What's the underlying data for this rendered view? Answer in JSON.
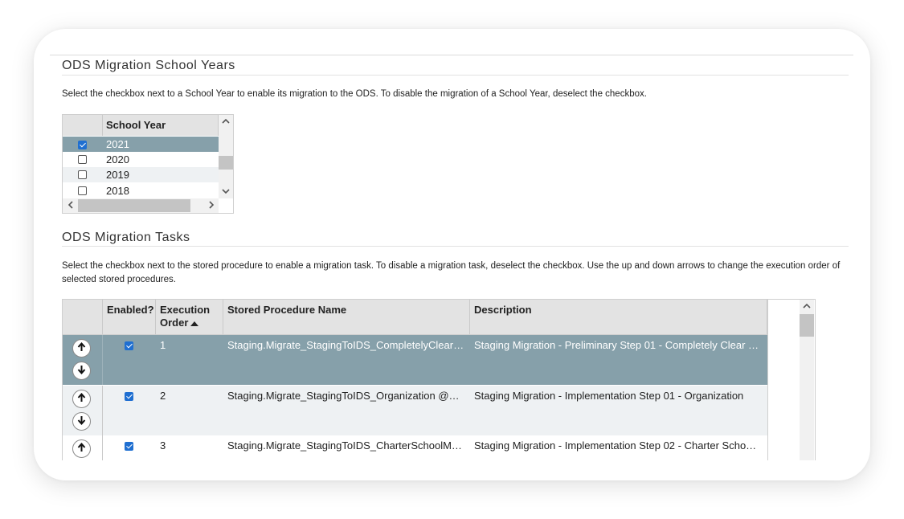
{
  "section_years": {
    "title": "ODS Migration School Years",
    "description": "Select the checkbox next to a School Year to enable its migration to the ODS. To disable the migration of a School Year, deselect the checkbox.",
    "grid": {
      "column_header": "School Year",
      "rows": [
        {
          "year": "2021",
          "checked": true,
          "selected": true
        },
        {
          "year": "2020",
          "checked": false,
          "selected": false
        },
        {
          "year": "2019",
          "checked": false,
          "selected": false
        },
        {
          "year": "2018",
          "checked": false,
          "selected": false
        }
      ]
    }
  },
  "section_tasks": {
    "title": "ODS Migration Tasks",
    "description": "Select the checkbox next to the stored procedure to enable a migration task. To disable a migration task, deselect the checkbox. Use the up and down arrows to change the execution order of selected stored procedures.",
    "grid": {
      "headers": {
        "enabled": "Enabled?",
        "order_line1": "Execution",
        "order_line2": "Order",
        "procedure": "Stored Procedure Name",
        "description": "Description"
      },
      "rows": [
        {
          "enabled": true,
          "order": "1",
          "procedure": "Staging.Migrate_StagingToIDS_CompletelyClear…",
          "description": "Staging Migration - Preliminary Step 01 - Completely Clear …"
        },
        {
          "enabled": true,
          "order": "2",
          "procedure": "Staging.Migrate_StagingToIDS_Organization @…",
          "description": "Staging Migration - Implementation Step 01 - Organization"
        },
        {
          "enabled": true,
          "order": "3",
          "procedure": "Staging.Migrate_StagingToIDS_CharterSchoolM…",
          "description": "Staging Migration - Implementation Step 02 - Charter Scho…"
        }
      ]
    }
  },
  "icons": {
    "move_up": "arrow-up-icon",
    "move_down": "arrow-down-icon",
    "scroll_up": "chevron-up-icon",
    "scroll_down": "chevron-down-icon",
    "scroll_left": "chevron-left-icon",
    "scroll_right": "chevron-right-icon",
    "sort": "sort-ascending-icon"
  },
  "colors": {
    "selected_row": "#86a0aa",
    "alt_row": "#eef1f3",
    "header_bg": "#e3e3e3",
    "checkbox_checked": "#1f6fd1"
  }
}
